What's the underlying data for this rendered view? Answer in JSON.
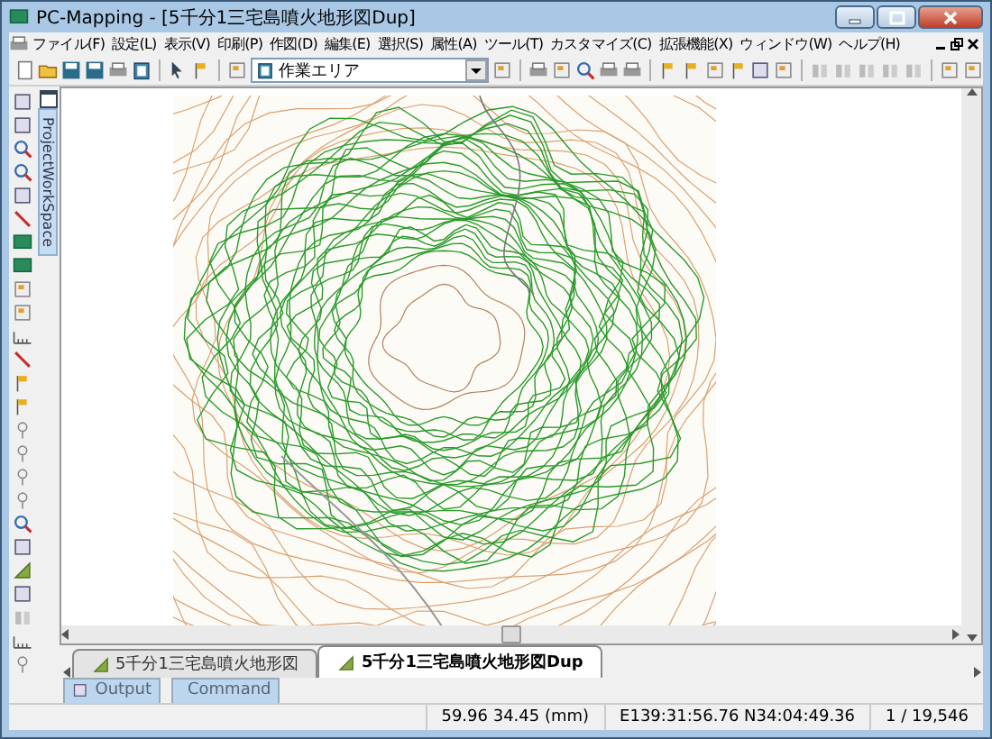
{
  "window": {
    "title": "PC-Mapping - [5千分1三宅島噴火地形図Dup]"
  },
  "menu": [
    "ファイル(F)",
    "設定(L)",
    "表示(V)",
    "印刷(P)",
    "作図(D)",
    "編集(E)",
    "選択(S)",
    "属性(A)",
    "ツール(T)",
    "カスタマイズ(C)",
    "拡張機能(X)",
    "ウィンドウ(W)",
    "ヘルプ(H)"
  ],
  "toolbar": {
    "layer_dropdown": {
      "value": "作業エリア"
    }
  },
  "sidebar": {
    "tab": "ProjectWorkSpace"
  },
  "document_tabs": [
    {
      "label": "5千分1三宅島噴火地形図",
      "selected": false
    },
    {
      "label": "5千分1三宅島噴火地形図Dup",
      "selected": true
    }
  ],
  "panel_tabs": [
    {
      "label": "Output"
    },
    {
      "label": "Command"
    }
  ],
  "status_bar": {
    "coordinates": "59.96 34.45 (mm)",
    "position": "E139:31:56.76 N34:04:49.36",
    "scale": "1 / 19,546"
  }
}
